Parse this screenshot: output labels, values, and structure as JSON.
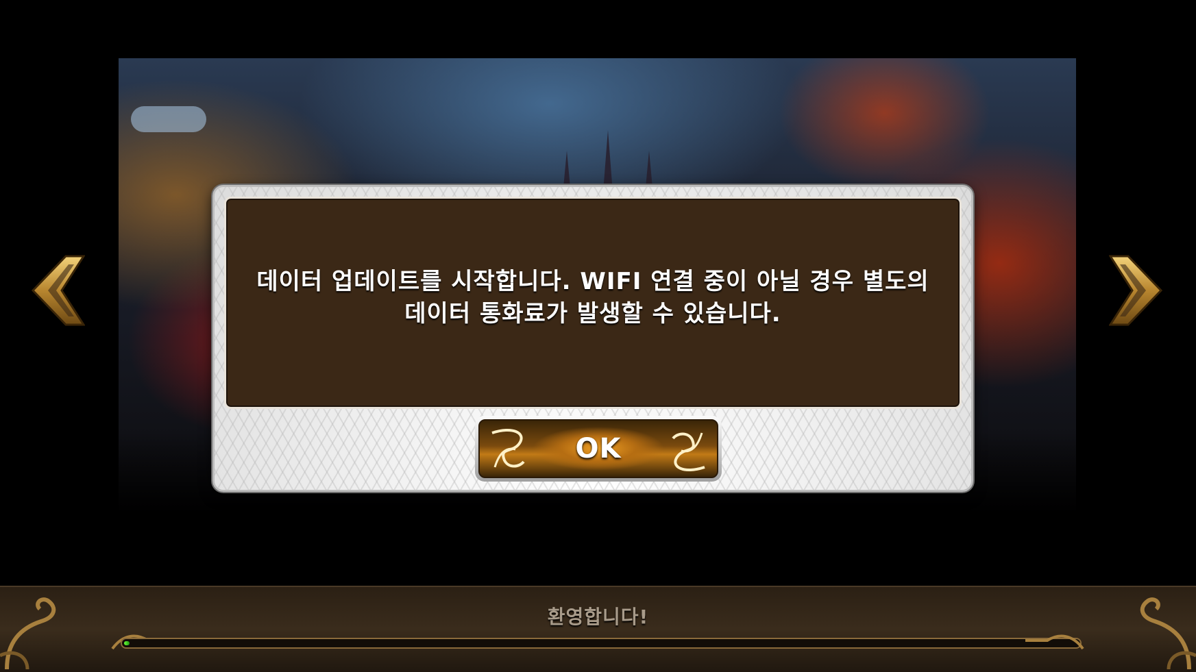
{
  "dialog": {
    "message_line1": "데이터 업데이트를 시작합니다. WIFI 연결 중이 아닐 경우 별도의",
    "message_line2": "데이터 통화료가 발생할 수 있습니다.",
    "ok_label": "OK"
  },
  "loading": {
    "welcome_text": "환영합니다!",
    "progress_fraction": 0.005
  },
  "colors": {
    "panel_brown": "#3b2816",
    "gold": "#b8862f",
    "progress_green": "#4fd42a"
  },
  "icons": {
    "left_arrow": "chevron-left-icon",
    "right_arrow": "chevron-right-icon"
  }
}
